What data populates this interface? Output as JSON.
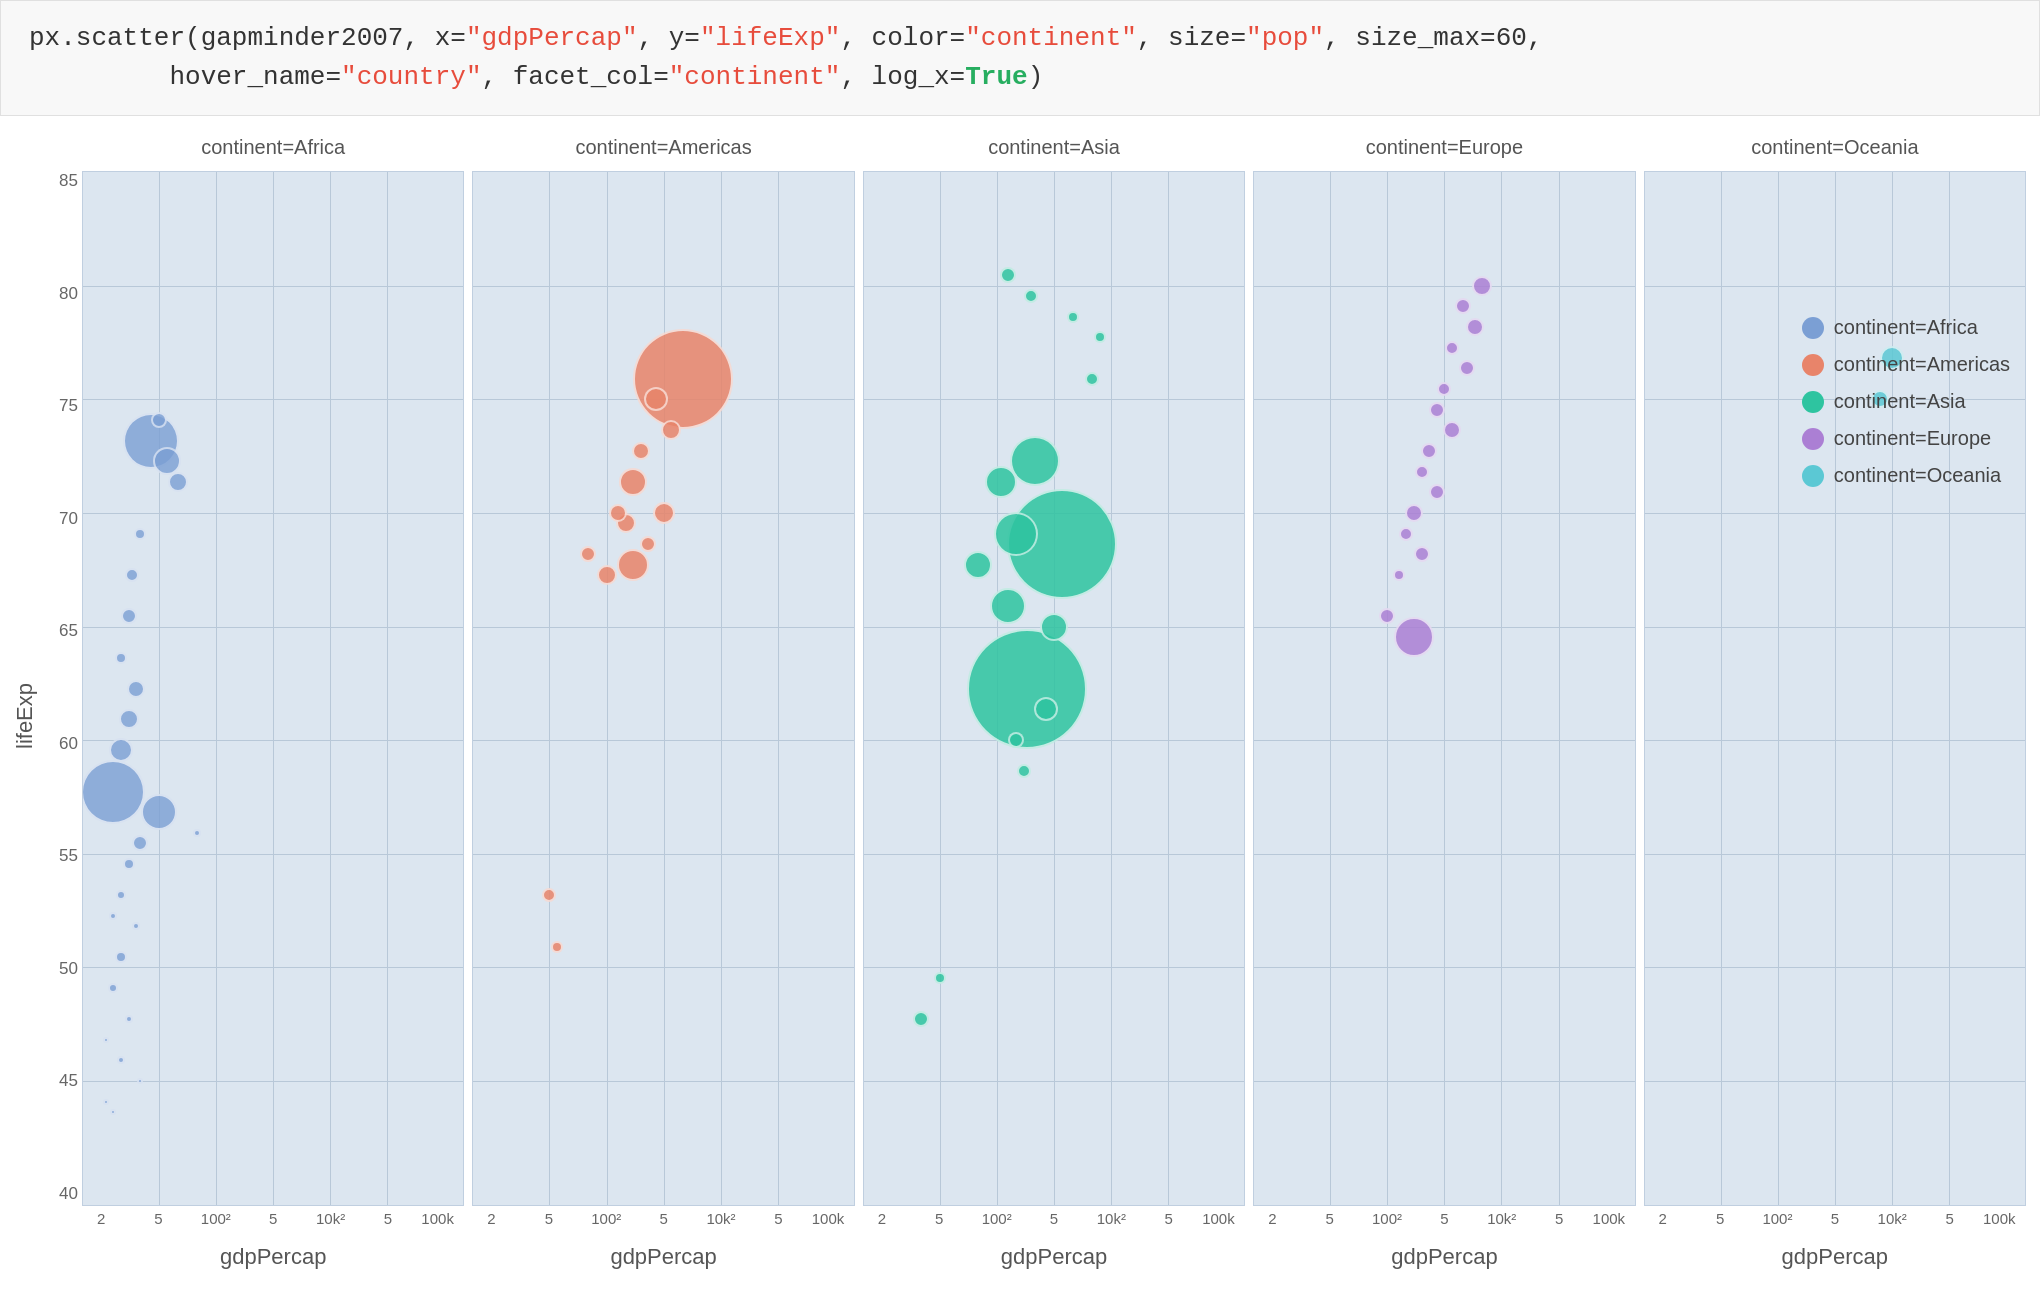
{
  "code": {
    "line1_prefix": "px.scatter(gapminder2007, x=",
    "line1_x": "\"gdpPercap\"",
    "line1_mid": ", y=",
    "line1_y": "\"lifeExp\"",
    "line1_mid2": ", color=",
    "line1_color": "\"continent\"",
    "line1_mid3": ", size=",
    "line1_size": "\"pop\"",
    "line1_mid4": ", size_max=",
    "line1_sizemax": "60",
    "line1_end": ",",
    "line2_prefix": "        hover_name=",
    "line2_hover": "\"country\"",
    "line2_mid": ", facet_col=",
    "line2_facet": "\"continent\"",
    "line2_mid2": ", log_x=",
    "line2_logx": "True",
    "line2_end": ")"
  },
  "chart": {
    "y_label": "lifeExp",
    "y_ticks": [
      "85",
      "80",
      "75",
      "70",
      "65",
      "60",
      "55",
      "50",
      "45",
      "40"
    ],
    "x_ticks": [
      "2",
      "5",
      "100²",
      "5",
      "10k²",
      "5",
      "100k"
    ],
    "x_axis_label": "gdpPercap",
    "facets": [
      {
        "title": "continent=Africa",
        "color": "#7b9fd4",
        "x_label": "gdpPercap",
        "bubbles": [
          {
            "cx": 18,
            "cy": 82,
            "r": 28
          },
          {
            "cx": 22,
            "cy": 80,
            "r": 14
          },
          {
            "cx": 20,
            "cy": 78,
            "r": 10
          },
          {
            "cx": 25,
            "cy": 76,
            "r": 8
          },
          {
            "cx": 18,
            "cy": 73,
            "r": 8
          },
          {
            "cx": 22,
            "cy": 72,
            "r": 18
          },
          {
            "cx": 28,
            "cy": 71,
            "r": 9
          },
          {
            "cx": 30,
            "cy": 70,
            "r": 6
          },
          {
            "cx": 15,
            "cy": 68,
            "r": 5
          },
          {
            "cx": 12,
            "cy": 65,
            "r": 6
          },
          {
            "cx": 10,
            "cy": 63,
            "r": 7
          },
          {
            "cx": 12,
            "cy": 61,
            "r": 8
          },
          {
            "cx": 14,
            "cy": 60,
            "r": 6
          },
          {
            "cx": 10,
            "cy": 58,
            "r": 10
          },
          {
            "cx": 12,
            "cy": 57,
            "r": 9
          },
          {
            "cx": 14,
            "cy": 56,
            "r": 7
          },
          {
            "cx": 10,
            "cy": 55,
            "r": 14
          },
          {
            "cx": 15,
            "cy": 54,
            "r": 12
          },
          {
            "cx": 20,
            "cy": 53,
            "r": 8
          },
          {
            "cx": 10,
            "cy": 51,
            "r": 32
          },
          {
            "cx": 22,
            "cy": 50,
            "r": 10
          },
          {
            "cx": 15,
            "cy": 49,
            "r": 18
          },
          {
            "cx": 18,
            "cy": 48,
            "r": 6
          },
          {
            "cx": 12,
            "cy": 47,
            "r": 8
          },
          {
            "cx": 10,
            "cy": 46,
            "r": 8
          },
          {
            "cx": 8,
            "cy": 45,
            "r": 7
          },
          {
            "cx": 12,
            "cy": 44,
            "r": 6
          },
          {
            "cx": 10,
            "cy": 43,
            "r": 7
          },
          {
            "cx": 8,
            "cy": 42,
            "r": 6
          },
          {
            "cx": 35,
            "cy": 45,
            "r": 5
          },
          {
            "cx": 16,
            "cy": 38,
            "r": 5
          }
        ]
      },
      {
        "title": "continent=Americas",
        "color": "#e8846a",
        "x_label": "gdpPercap",
        "bubbles": [
          {
            "cx": 55,
            "cy": 16,
            "r": 50
          },
          {
            "cx": 48,
            "cy": 24,
            "r": 12
          },
          {
            "cx": 52,
            "cy": 26,
            "r": 10
          },
          {
            "cx": 44,
            "cy": 28,
            "r": 9
          },
          {
            "cx": 42,
            "cy": 30,
            "r": 14
          },
          {
            "cx": 50,
            "cy": 32,
            "r": 11
          },
          {
            "cx": 40,
            "cy": 34,
            "r": 10
          },
          {
            "cx": 38,
            "cy": 33,
            "r": 9
          },
          {
            "cx": 45,
            "cy": 36,
            "r": 8
          },
          {
            "cx": 42,
            "cy": 38,
            "r": 16
          },
          {
            "cx": 35,
            "cy": 39,
            "r": 10
          },
          {
            "cx": 30,
            "cy": 37,
            "r": 8
          },
          {
            "cx": 20,
            "cy": 72,
            "r": 7
          },
          {
            "cx": 22,
            "cy": 66,
            "r": 6
          }
        ]
      },
      {
        "title": "continent=Asia",
        "color": "#2ec4a0",
        "x_label": "gdpPercap",
        "bubbles": [
          {
            "cx": 40,
            "cy": 10,
            "r": 18
          },
          {
            "cx": 45,
            "cy": 15,
            "r": 60
          },
          {
            "cx": 55,
            "cy": 26,
            "r": 55
          },
          {
            "cx": 50,
            "cy": 34,
            "r": 42
          },
          {
            "cx": 42,
            "cy": 20,
            "r": 20
          },
          {
            "cx": 38,
            "cy": 28,
            "r": 25
          },
          {
            "cx": 35,
            "cy": 36,
            "r": 22
          },
          {
            "cx": 30,
            "cy": 30,
            "r": 16
          },
          {
            "cx": 52,
            "cy": 40,
            "r": 18
          },
          {
            "cx": 48,
            "cy": 44,
            "r": 14
          },
          {
            "cx": 42,
            "cy": 42,
            "r": 12
          },
          {
            "cx": 38,
            "cy": 22,
            "r": 10
          },
          {
            "cx": 55,
            "cy": 18,
            "r": 8
          },
          {
            "cx": 60,
            "cy": 20,
            "r": 7
          },
          {
            "cx": 62,
            "cy": 22,
            "r": 6
          },
          {
            "cx": 45,
            "cy": 48,
            "r": 8
          },
          {
            "cx": 40,
            "cy": 50,
            "r": 7
          },
          {
            "cx": 15,
            "cy": 82,
            "r": 8
          },
          {
            "cx": 20,
            "cy": 78,
            "r": 6
          }
        ]
      },
      {
        "title": "continent=Europe",
        "color": "#ab7fd4",
        "x_label": "gdpPercap",
        "bubbles": [
          {
            "cx": 60,
            "cy": 12,
            "r": 10
          },
          {
            "cx": 55,
            "cy": 14,
            "r": 8
          },
          {
            "cx": 58,
            "cy": 16,
            "r": 9
          },
          {
            "cx": 52,
            "cy": 18,
            "r": 7
          },
          {
            "cx": 56,
            "cy": 20,
            "r": 8
          },
          {
            "cx": 50,
            "cy": 22,
            "r": 7
          },
          {
            "cx": 48,
            "cy": 24,
            "r": 8
          },
          {
            "cx": 52,
            "cy": 26,
            "r": 9
          },
          {
            "cx": 46,
            "cy": 28,
            "r": 8
          },
          {
            "cx": 44,
            "cy": 30,
            "r": 7
          },
          {
            "cx": 48,
            "cy": 32,
            "r": 8
          },
          {
            "cx": 42,
            "cy": 34,
            "r": 9
          },
          {
            "cx": 40,
            "cy": 36,
            "r": 7
          },
          {
            "cx": 44,
            "cy": 38,
            "r": 8
          },
          {
            "cx": 38,
            "cy": 40,
            "r": 6
          },
          {
            "cx": 42,
            "cy": 46,
            "r": 20
          },
          {
            "cx": 35,
            "cy": 44,
            "r": 8
          }
        ]
      },
      {
        "title": "continent=Oceania",
        "color": "#5bc8d4",
        "x_label": "gdpPercap",
        "bubbles": [
          {
            "cx": 65,
            "cy": 18,
            "r": 12
          },
          {
            "cx": 62,
            "cy": 22,
            "r": 9
          }
        ]
      }
    ],
    "legend": [
      {
        "label": "continent=Africa",
        "color": "#7b9fd4"
      },
      {
        "label": "continent=Americas",
        "color": "#e8846a"
      },
      {
        "label": "continent=Asia",
        "color": "#2ec4a0"
      },
      {
        "label": "continent=Europe",
        "color": "#ab7fd4"
      },
      {
        "label": "continent=Oceania",
        "color": "#5bc8d4"
      }
    ]
  }
}
